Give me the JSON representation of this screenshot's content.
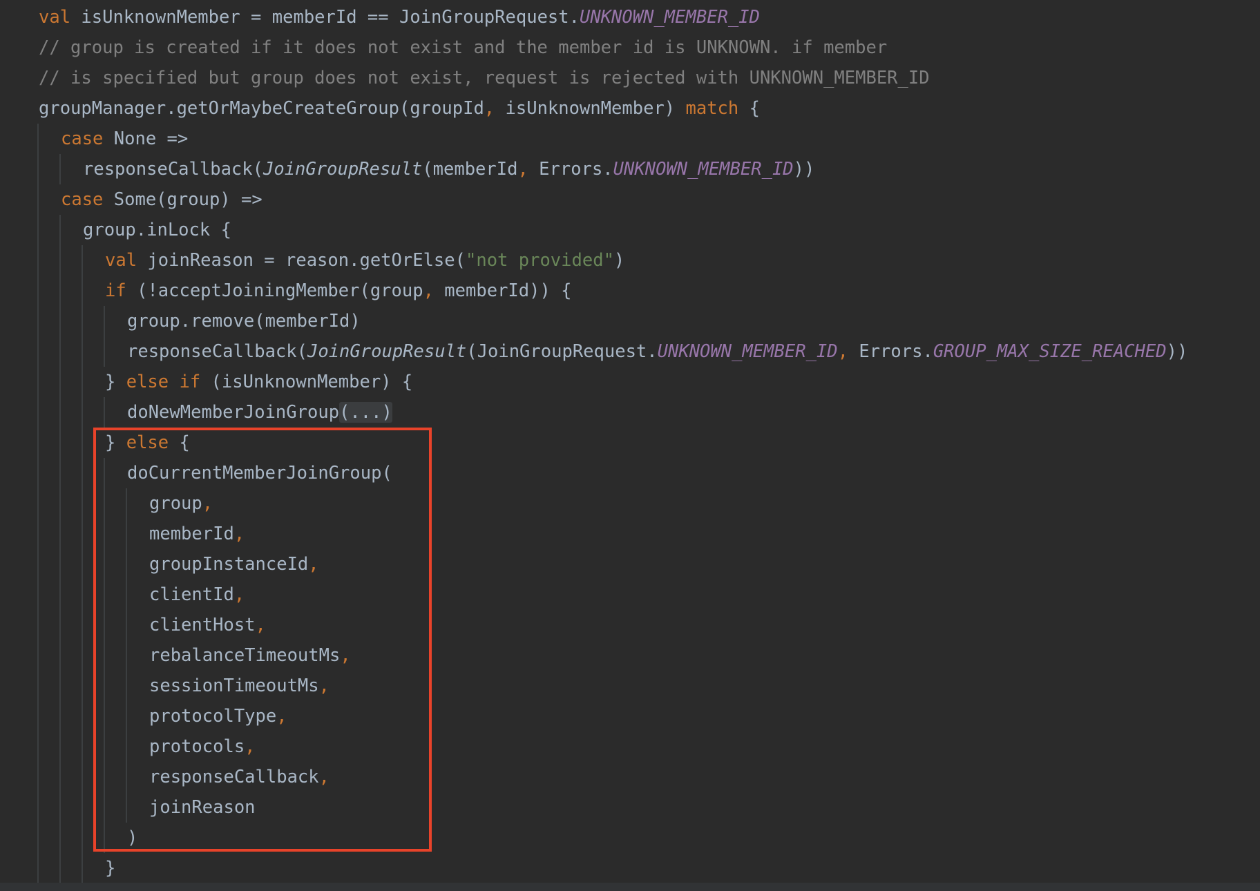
{
  "colors": {
    "background": "#2b2b2b",
    "plain": "#a9b7c6",
    "keyword": "#cc7832",
    "constant": "#9876aa",
    "comment": "#808080",
    "string": "#6a8759",
    "highlight_box": "#e8432a"
  },
  "code": {
    "lines": [
      {
        "tokens": [
          {
            "t": "val",
            "k": "kw"
          },
          {
            "t": " isUnknownMember = memberId == JoinGroupRequest.",
            "k": "plain"
          },
          {
            "t": "UNKNOWN_MEMBER_ID",
            "k": "const"
          }
        ]
      },
      {
        "tokens": [
          {
            "t": "// group is created if it does not exist and the member id is UNKNOWN. if member",
            "k": "comment"
          }
        ]
      },
      {
        "tokens": [
          {
            "t": "// is specified but group does not exist, request is rejected with UNKNOWN_MEMBER_ID",
            "k": "comment"
          }
        ]
      },
      {
        "tokens": [
          {
            "t": "groupManager.getOrMaybeCreateGroup(groupId",
            "k": "plain"
          },
          {
            "t": ",",
            "k": "punct"
          },
          {
            "t": " isUnknownMember) ",
            "k": "plain"
          },
          {
            "t": "match",
            "k": "kw"
          },
          {
            "t": " {",
            "k": "plain"
          }
        ]
      },
      {
        "tokens": [
          {
            "t": "case",
            "k": "kw"
          },
          {
            "t": " None =>",
            "k": "plain"
          }
        ]
      },
      {
        "tokens": [
          {
            "t": "responseCallback(",
            "k": "plain"
          },
          {
            "t": "JoinGroupResult",
            "k": "fn"
          },
          {
            "t": "(memberId",
            "k": "plain"
          },
          {
            "t": ",",
            "k": "punct"
          },
          {
            "t": " Errors.",
            "k": "plain"
          },
          {
            "t": "UNKNOWN_MEMBER_ID",
            "k": "const"
          },
          {
            "t": "))",
            "k": "plain"
          }
        ]
      },
      {
        "tokens": [
          {
            "t": "case",
            "k": "kw"
          },
          {
            "t": " Some(group) =>",
            "k": "plain"
          }
        ]
      },
      {
        "tokens": [
          {
            "t": "group.inLock {",
            "k": "plain"
          }
        ]
      },
      {
        "tokens": [
          {
            "t": "val",
            "k": "kw"
          },
          {
            "t": " joinReason = reason.getOrElse(",
            "k": "plain"
          },
          {
            "t": "\"not provided\"",
            "k": "str"
          },
          {
            "t": ")",
            "k": "plain"
          }
        ]
      },
      {
        "tokens": [
          {
            "t": "if",
            "k": "kw"
          },
          {
            "t": " (!acceptJoiningMember(group",
            "k": "plain"
          },
          {
            "t": ",",
            "k": "punct"
          },
          {
            "t": " memberId)) {",
            "k": "plain"
          }
        ]
      },
      {
        "tokens": [
          {
            "t": "group.remove(memberId)",
            "k": "plain"
          }
        ]
      },
      {
        "tokens": [
          {
            "t": "responseCallback(",
            "k": "plain"
          },
          {
            "t": "JoinGroupResult",
            "k": "fn"
          },
          {
            "t": "(JoinGroupRequest.",
            "k": "plain"
          },
          {
            "t": "UNKNOWN_MEMBER_ID",
            "k": "const"
          },
          {
            "t": ",",
            "k": "punct"
          },
          {
            "t": " Errors.",
            "k": "plain"
          },
          {
            "t": "GROUP_MAX_SIZE_REACHED",
            "k": "const"
          },
          {
            "t": "))",
            "k": "plain"
          }
        ]
      },
      {
        "tokens": [
          {
            "t": "} ",
            "k": "plain"
          },
          {
            "t": "else if",
            "k": "kw"
          },
          {
            "t": " (isUnknownMember) {",
            "k": "plain"
          }
        ]
      },
      {
        "tokens": [
          {
            "t": "doNewMemberJoinGroup",
            "k": "plain"
          },
          {
            "t": "(...)",
            "k": "fold"
          }
        ]
      },
      {
        "tokens": [
          {
            "t": "} ",
            "k": "plain"
          },
          {
            "t": "else",
            "k": "kw"
          },
          {
            "t": " {",
            "k": "plain"
          }
        ]
      },
      {
        "tokens": [
          {
            "t": "doCurrentMemberJoinGroup(",
            "k": "plain"
          }
        ]
      },
      {
        "tokens": [
          {
            "t": "group",
            "k": "plain"
          },
          {
            "t": ",",
            "k": "punct"
          }
        ]
      },
      {
        "tokens": [
          {
            "t": "memberId",
            "k": "plain"
          },
          {
            "t": ",",
            "k": "punct"
          }
        ]
      },
      {
        "tokens": [
          {
            "t": "groupInstanceId",
            "k": "plain"
          },
          {
            "t": ",",
            "k": "punct"
          }
        ]
      },
      {
        "tokens": [
          {
            "t": "clientId",
            "k": "plain"
          },
          {
            "t": ",",
            "k": "punct"
          }
        ]
      },
      {
        "tokens": [
          {
            "t": "clientHost",
            "k": "plain"
          },
          {
            "t": ",",
            "k": "punct"
          }
        ]
      },
      {
        "tokens": [
          {
            "t": "rebalanceTimeoutMs",
            "k": "plain"
          },
          {
            "t": ",",
            "k": "punct"
          }
        ]
      },
      {
        "tokens": [
          {
            "t": "sessionTimeoutMs",
            "k": "plain"
          },
          {
            "t": ",",
            "k": "punct"
          }
        ]
      },
      {
        "tokens": [
          {
            "t": "protocolType",
            "k": "plain"
          },
          {
            "t": ",",
            "k": "punct"
          }
        ]
      },
      {
        "tokens": [
          {
            "t": "protocols",
            "k": "plain"
          },
          {
            "t": ",",
            "k": "punct"
          }
        ]
      },
      {
        "tokens": [
          {
            "t": "responseCallback",
            "k": "plain"
          },
          {
            "t": ",",
            "k": "punct"
          }
        ]
      },
      {
        "tokens": [
          {
            "t": "joinReason",
            "k": "plain"
          }
        ]
      },
      {
        "tokens": [
          {
            "t": ")",
            "k": "plain"
          }
        ]
      },
      {
        "tokens": [
          {
            "t": "}",
            "k": "plain"
          }
        ]
      }
    ]
  }
}
